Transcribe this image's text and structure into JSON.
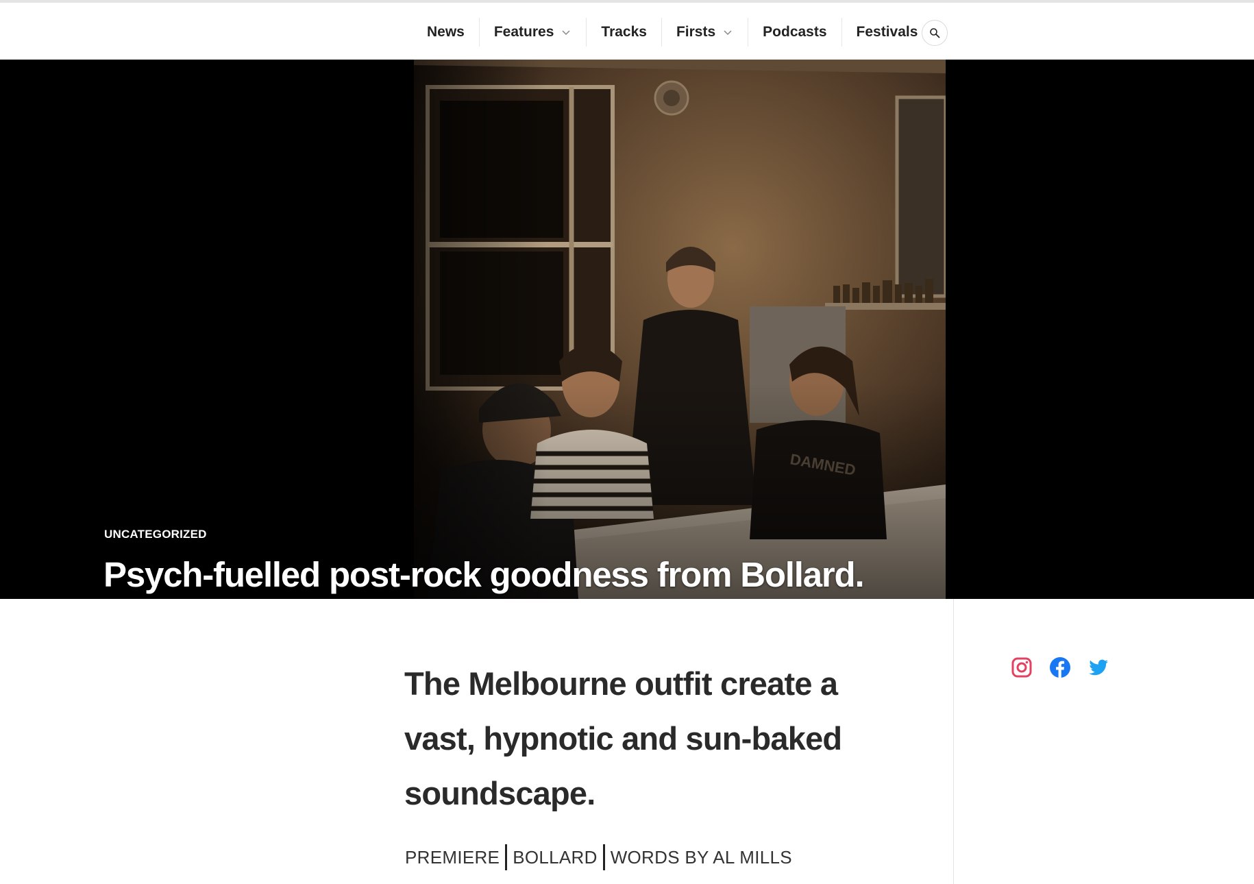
{
  "nav": {
    "items": [
      {
        "label": "News",
        "has_dropdown": false
      },
      {
        "label": "Features",
        "has_dropdown": true
      },
      {
        "label": "Tracks",
        "has_dropdown": false
      },
      {
        "label": "Firsts",
        "has_dropdown": true
      },
      {
        "label": "Podcasts",
        "has_dropdown": false
      },
      {
        "label": "Festivals",
        "has_dropdown": false
      }
    ],
    "search_icon": "search-icon"
  },
  "hero": {
    "category": "UNCATEGORIZED",
    "title": "Psych-fuelled post-rock goodness from Bollard."
  },
  "article": {
    "standfirst": "The Melbourne outfit create a vast, hypnotic and sun-baked soundscape.",
    "meta": [
      "PREMIERE",
      "BOLLARD",
      "WORDS BY AL MILLS"
    ]
  },
  "social": {
    "icons": [
      "instagram-icon",
      "facebook-icon",
      "twitter-icon"
    ],
    "colors": {
      "instagram": "#e4405f",
      "facebook": "#1877f2",
      "twitter": "#1da1f2"
    }
  }
}
